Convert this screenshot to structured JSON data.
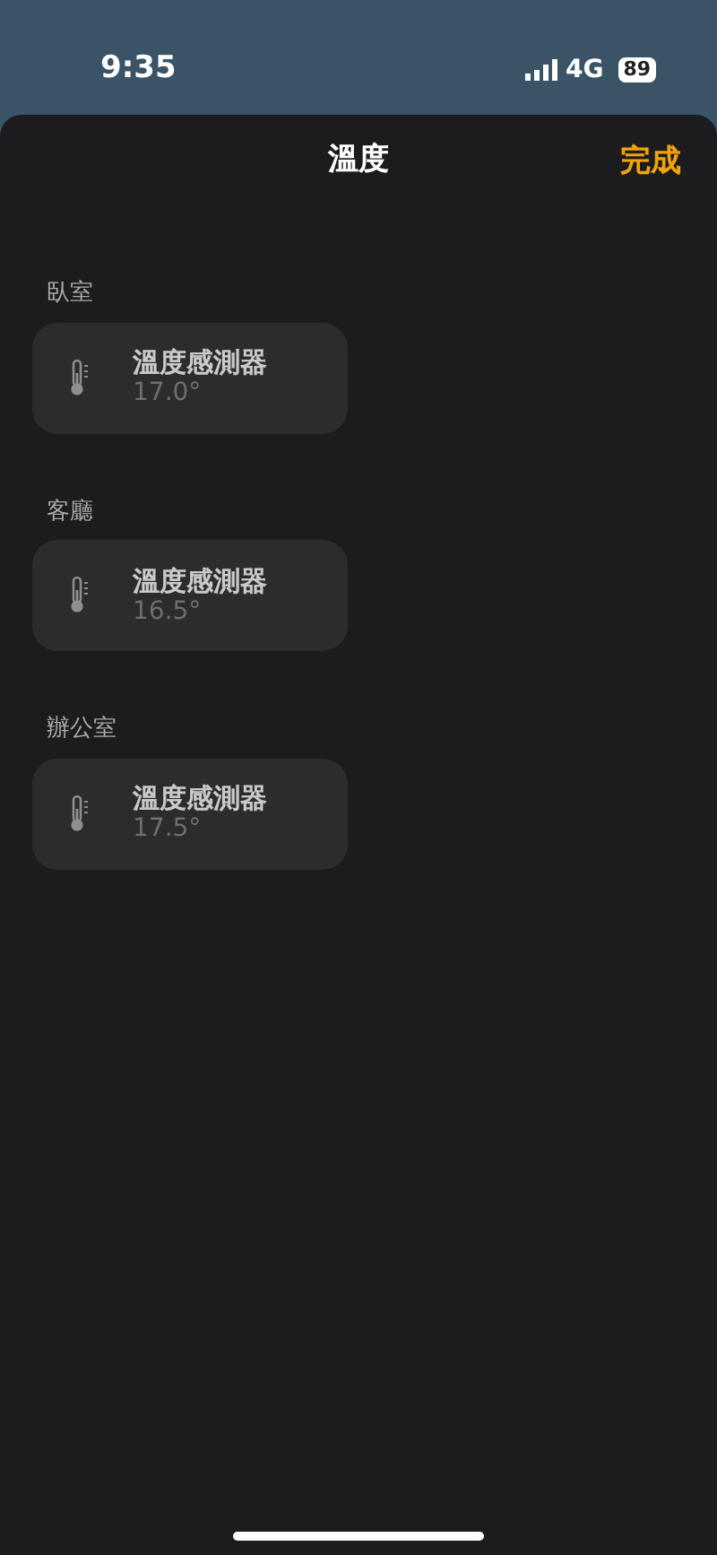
{
  "status_bar": {
    "time": "9:35",
    "network": "4G",
    "battery": "89"
  },
  "header": {
    "title": "溫度",
    "done": "完成"
  },
  "rooms": [
    {
      "name": "臥室",
      "sensor": {
        "name": "溫度感測器",
        "reading": "17.0°"
      }
    },
    {
      "name": "客廳",
      "sensor": {
        "name": "溫度感測器",
        "reading": "16.5°"
      }
    },
    {
      "name": "辦公室",
      "sensor": {
        "name": "溫度感測器",
        "reading": "17.5°"
      }
    }
  ]
}
